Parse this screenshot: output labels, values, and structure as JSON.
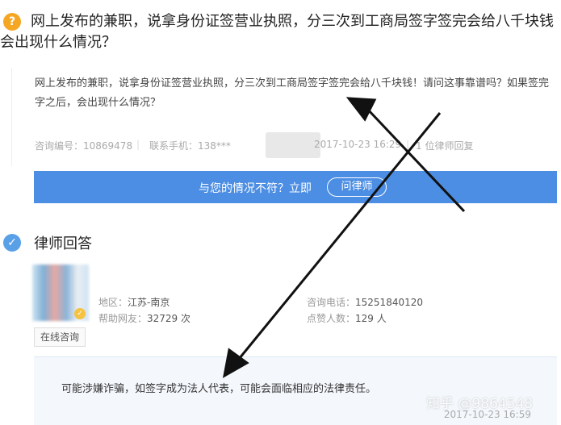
{
  "question": {
    "icon": "?",
    "title": "网上发布的兼职，说拿身份证签营业执照，分三次到工商局签字签完会给八千块钱会出现什么情况？",
    "body": "网上发布的兼职，说拿身份证签营业执照，分三次到工商局签字签完会给八千块钱！请问这事靠谱吗？如果签完字之后，会出现什么情况？",
    "consult_no": "咨询编号：10869478",
    "phone": "联系手机：138***",
    "datetime": "2017-10-23 16:29",
    "lawyer_replies": "1 位律师回复"
  },
  "cta": {
    "text": "与您的情况不符？立即",
    "button": "问律师",
    "color": "#4c8ee3"
  },
  "answer_section": {
    "title": "律师回答",
    "online_button": "在线咨询",
    "region_label": "地区：",
    "region_value": "江苏-南京",
    "helped_label": "帮助网友：",
    "helped_value": "32729 次",
    "phone_label": "咨询电话：",
    "phone_value": "15251840120",
    "likes_label": "点赞人数：",
    "likes_value": "129 人",
    "answer_text": "可能涉嫌诈骗，如签字成为法人代表，可能会面临相应的法律责任。",
    "answer_time": "2017-10-23 16:59"
  },
  "watermark": "知乎 @9864548",
  "icons": [
    "question-icon",
    "check-icon",
    "verified-badge-icon",
    "arrow-annotation"
  ]
}
